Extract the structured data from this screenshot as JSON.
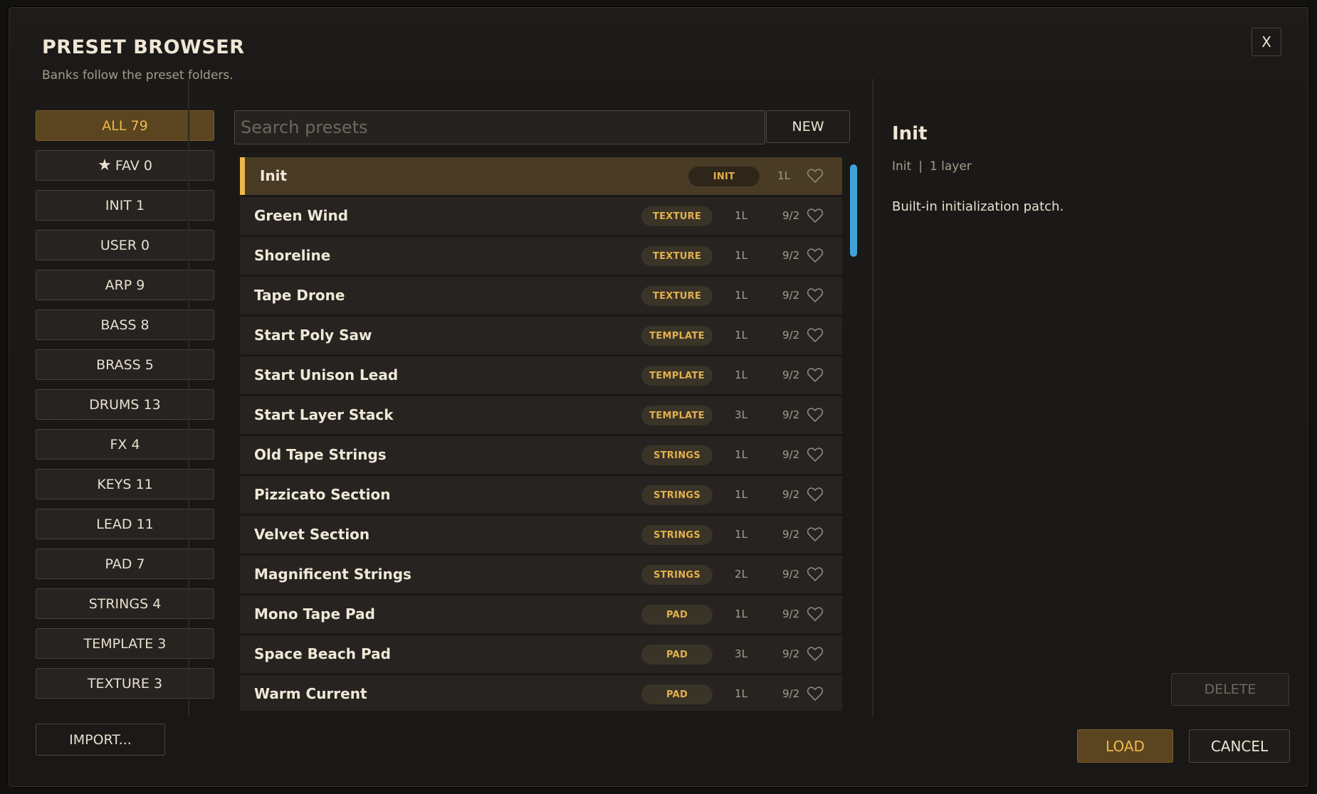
{
  "dialog": {
    "title": "PRESET BROWSER",
    "subtitle": "Banks follow the preset folders.",
    "close_label": "X"
  },
  "banks": [
    {
      "label": "ALL 79",
      "active": true
    },
    {
      "label": "FAV 0",
      "icon": "star-icon",
      "active": false
    },
    {
      "label": "INIT 1",
      "active": false
    },
    {
      "label": "USER 0",
      "active": false
    },
    {
      "label": "ARP 9",
      "active": false
    },
    {
      "label": "BASS 8",
      "active": false
    },
    {
      "label": "BRASS 5",
      "active": false
    },
    {
      "label": "DRUMS 13",
      "active": false
    },
    {
      "label": "FX 4",
      "active": false
    },
    {
      "label": "KEYS 11",
      "active": false
    },
    {
      "label": "LEAD 11",
      "active": false
    },
    {
      "label": "PAD 7",
      "active": false
    },
    {
      "label": "STRINGS 4",
      "active": false
    },
    {
      "label": "TEMPLATE 3",
      "active": false
    },
    {
      "label": "TEXTURE 3",
      "active": false
    }
  ],
  "import_label": "IMPORT...",
  "search": {
    "placeholder": "Search presets",
    "value": ""
  },
  "new_label": "NEW",
  "presets": [
    {
      "name": "Init",
      "tag": "INIT",
      "layers": "1L",
      "sig": "",
      "selected": true
    },
    {
      "name": "Green Wind",
      "tag": "TEXTURE",
      "layers": "1L",
      "sig": "9/2",
      "selected": false
    },
    {
      "name": "Shoreline",
      "tag": "TEXTURE",
      "layers": "1L",
      "sig": "9/2",
      "selected": false
    },
    {
      "name": "Tape Drone",
      "tag": "TEXTURE",
      "layers": "1L",
      "sig": "9/2",
      "selected": false
    },
    {
      "name": "Start Poly Saw",
      "tag": "TEMPLATE",
      "layers": "1L",
      "sig": "9/2",
      "selected": false
    },
    {
      "name": "Start Unison Lead",
      "tag": "TEMPLATE",
      "layers": "1L",
      "sig": "9/2",
      "selected": false
    },
    {
      "name": "Start Layer Stack",
      "tag": "TEMPLATE",
      "layers": "3L",
      "sig": "9/2",
      "selected": false
    },
    {
      "name": "Old Tape Strings",
      "tag": "STRINGS",
      "layers": "1L",
      "sig": "9/2",
      "selected": false
    },
    {
      "name": "Pizzicato Section",
      "tag": "STRINGS",
      "layers": "1L",
      "sig": "9/2",
      "selected": false
    },
    {
      "name": "Velvet Section",
      "tag": "STRINGS",
      "layers": "1L",
      "sig": "9/2",
      "selected": false
    },
    {
      "name": "Magnificent Strings",
      "tag": "STRINGS",
      "layers": "2L",
      "sig": "9/2",
      "selected": false
    },
    {
      "name": "Mono Tape Pad",
      "tag": "PAD",
      "layers": "1L",
      "sig": "9/2",
      "selected": false
    },
    {
      "name": "Space Beach Pad",
      "tag": "PAD",
      "layers": "3L",
      "sig": "9/2",
      "selected": false
    },
    {
      "name": "Warm Current",
      "tag": "PAD",
      "layers": "1L",
      "sig": "9/2",
      "selected": false
    }
  ],
  "detail": {
    "title": "Init",
    "category": "Init",
    "separator": "|",
    "layers": "1 layer",
    "description": "Built-in initialization patch."
  },
  "actions": {
    "delete_label": "DELETE",
    "load_label": "LOAD",
    "cancel_label": "CANCEL"
  },
  "colors": {
    "accent": "#e8b84a",
    "active_bg": "#5a4520",
    "scrollbar": "#3fa3d8"
  }
}
